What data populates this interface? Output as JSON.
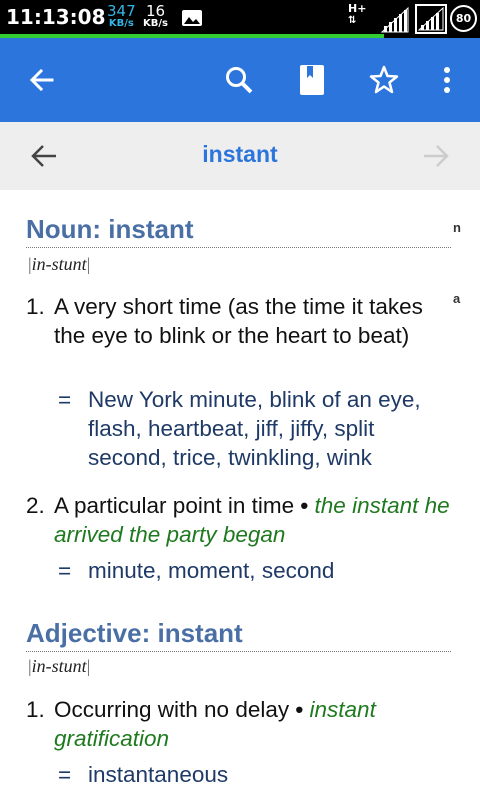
{
  "status_bar": {
    "time": "11:13:08",
    "upload_speed": "347",
    "upload_unit": "KB/s",
    "download_speed": "16",
    "download_unit": "KB/s",
    "network_type": "H+",
    "battery": "80",
    "accent_color": "#33b5e5",
    "progress_color": "#33cc33"
  },
  "app_bar": {
    "color": "#2c75dd",
    "icons": [
      "back-arrow-icon",
      "search-icon",
      "bookmark-icon",
      "star-icon",
      "more-vert-icon"
    ]
  },
  "nav": {
    "title": "instant",
    "icons": [
      "back-arrow-icon",
      "forward-arrow-icon"
    ]
  },
  "side_index": [
    "n",
    "a"
  ],
  "entries": [
    {
      "heading": "Noun: instant",
      "pronunciation": "in-stunt",
      "definitions": [
        {
          "number": "1.",
          "text": "A very short time (as the time it takes the eye to blink or the heart to beat)",
          "example": "",
          "synonyms": "New York minute, blink of an eye, flash, heartbeat, jiff, jiffy, split second, trice, twinkling, wink"
        },
        {
          "number": "2.",
          "text": "A particular point in time",
          "example": "the instant he arrived the party began",
          "synonyms": "minute, moment, second"
        }
      ]
    },
    {
      "heading": "Adjective: instant",
      "pronunciation": "in-stunt",
      "definitions": [
        {
          "number": "1.",
          "text": "Occurring with no delay",
          "example": "instant gratification",
          "synonyms": "instantaneous"
        }
      ]
    }
  ],
  "synonym_marker": "=",
  "example_bullet": "•",
  "colors": {
    "heading": "#4a6fa5",
    "example": "#1f7a1f",
    "nav_background": "#eeeeee"
  }
}
